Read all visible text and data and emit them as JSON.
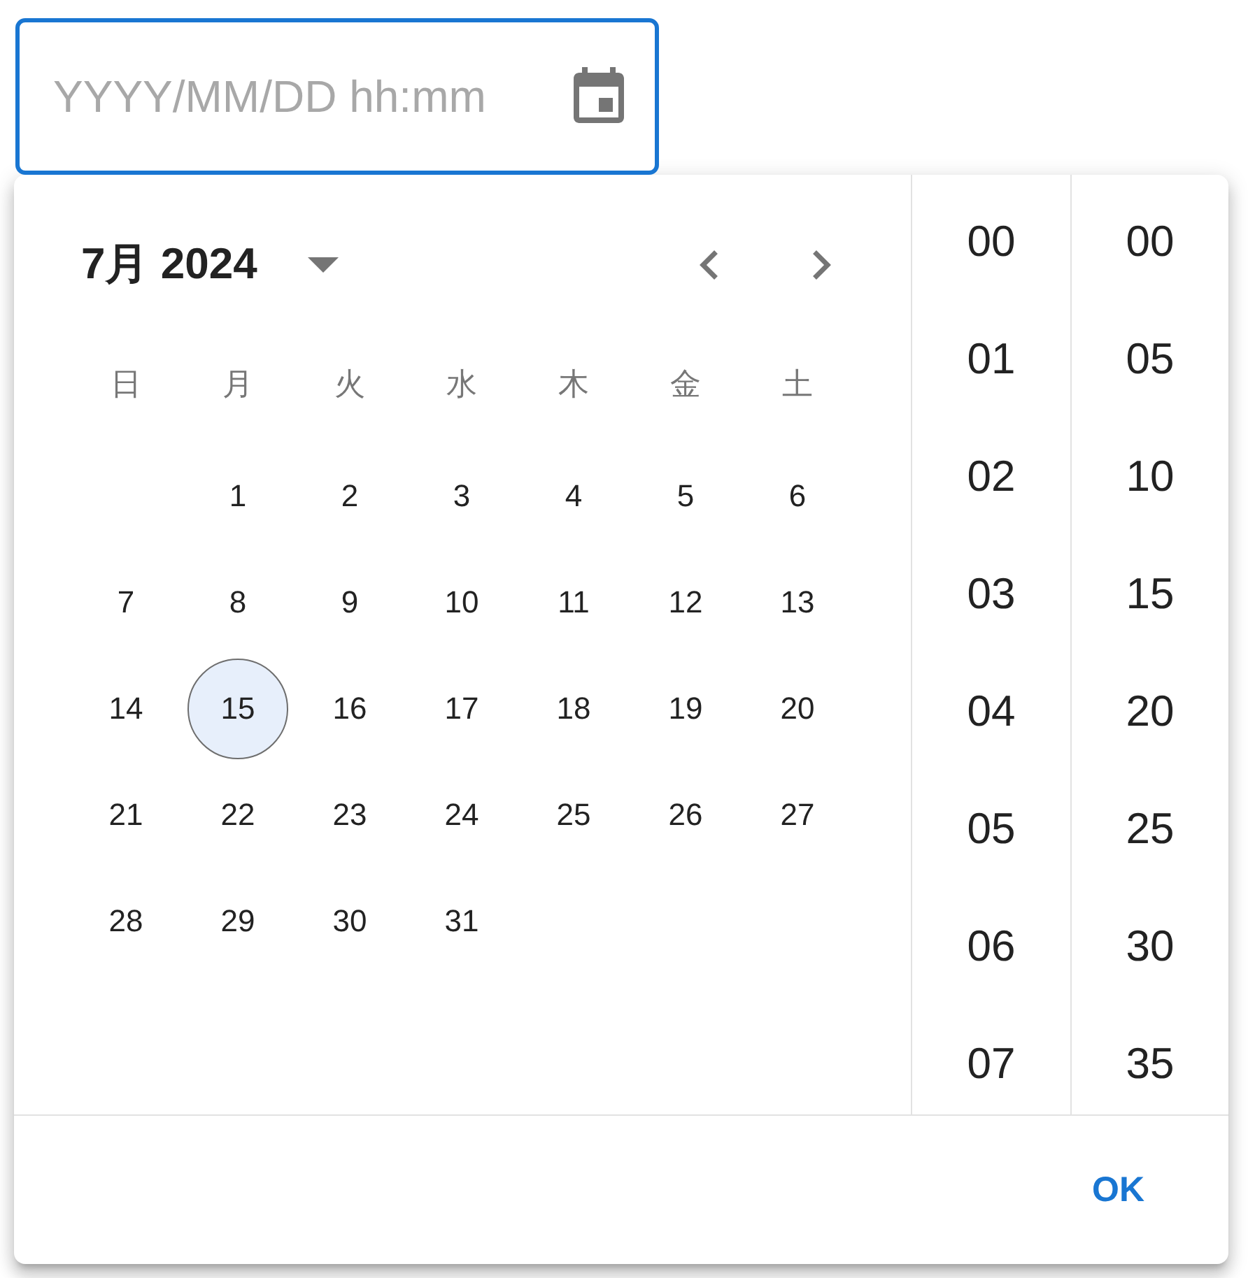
{
  "date_field": {
    "placeholder": "YYYY/MM/DD hh:mm",
    "focused": true
  },
  "calendar": {
    "month_label": "7月 2024",
    "weekdays": [
      "日",
      "月",
      "火",
      "水",
      "木",
      "金",
      "土"
    ],
    "weeks": [
      {
        "days": [
          {
            "label": "1",
            "selected": false
          },
          {
            "label": "2",
            "selected": false
          },
          {
            "label": "3",
            "selected": false
          },
          {
            "label": "4",
            "selected": false
          },
          {
            "label": "5",
            "selected": false
          },
          {
            "label": "6",
            "selected": false
          }
        ]
      },
      {
        "days": [
          {
            "label": "7",
            "selected": false
          },
          {
            "label": "8",
            "selected": false
          },
          {
            "label": "9",
            "selected": false
          },
          {
            "label": "10",
            "selected": false
          },
          {
            "label": "11",
            "selected": false
          },
          {
            "label": "12",
            "selected": false
          },
          {
            "label": "13",
            "selected": false
          }
        ]
      },
      {
        "days": [
          {
            "label": "14",
            "selected": false
          },
          {
            "label": "15",
            "selected": true
          },
          {
            "label": "16",
            "selected": false
          },
          {
            "label": "17",
            "selected": false
          },
          {
            "label": "18",
            "selected": false
          },
          {
            "label": "19",
            "selected": false
          },
          {
            "label": "20",
            "selected": false
          }
        ]
      },
      {
        "days": [
          {
            "label": "21",
            "selected": false
          },
          {
            "label": "22",
            "selected": false
          },
          {
            "label": "23",
            "selected": false
          },
          {
            "label": "24",
            "selected": false
          },
          {
            "label": "25",
            "selected": false
          },
          {
            "label": "26",
            "selected": false
          },
          {
            "label": "27",
            "selected": false
          }
        ]
      },
      {
        "days": [
          {
            "label": "28",
            "selected": false
          },
          {
            "label": "29",
            "selected": false
          },
          {
            "label": "30",
            "selected": false
          },
          {
            "label": "31",
            "selected": false
          }
        ]
      }
    ]
  },
  "time": {
    "hours": [
      {
        "label": "00",
        "selected": false
      },
      {
        "label": "01",
        "selected": false
      },
      {
        "label": "02",
        "selected": false
      },
      {
        "label": "03",
        "selected": false
      },
      {
        "label": "04",
        "selected": false
      },
      {
        "label": "05",
        "selected": false
      },
      {
        "label": "06",
        "selected": false
      },
      {
        "label": "07",
        "selected": false
      }
    ],
    "minutes": [
      {
        "label": "00",
        "selected": false
      },
      {
        "label": "05",
        "selected": false
      },
      {
        "label": "10",
        "selected": false
      },
      {
        "label": "15",
        "selected": false
      },
      {
        "label": "20",
        "selected": false
      },
      {
        "label": "25",
        "selected": false
      },
      {
        "label": "30",
        "selected": false
      },
      {
        "label": "35",
        "selected": false
      }
    ]
  },
  "footer": {
    "ok_button": "OK"
  }
}
